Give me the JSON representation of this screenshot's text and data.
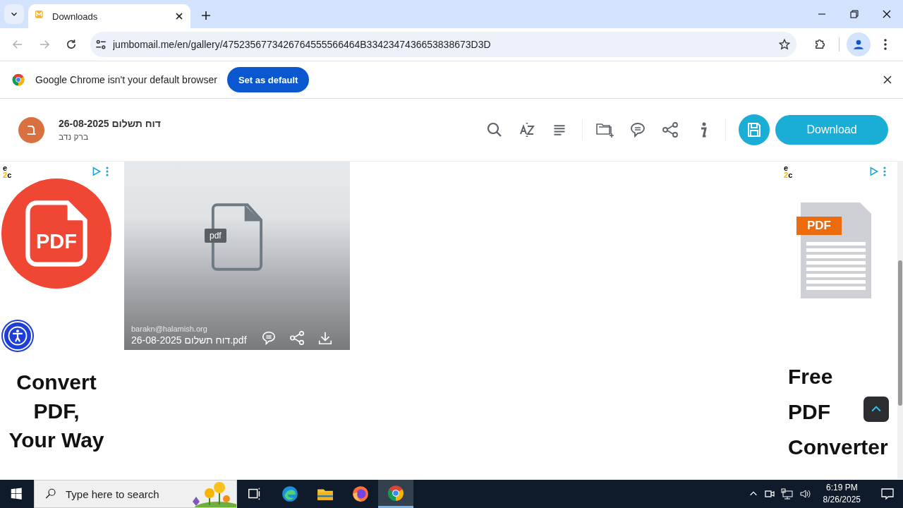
{
  "browser": {
    "tabs": [
      {
        "title": "Downloads",
        "selected": true
      }
    ],
    "address": "jumbomail.me/en/gallery/4752356773426764555566464B3342347436653838673D3D",
    "infobar": {
      "message": "Google Chrome isn't your default browser",
      "button": "Set as default"
    }
  },
  "header": {
    "avatar_letter": "ב",
    "title": "דוח תשלום 26-08-2025",
    "subtitle": "ברק נדב",
    "download_button": "Download"
  },
  "left_ad": {
    "logo_lines": [
      "e",
      "2c"
    ],
    "icon_text": "PDF",
    "headline_lines": [
      "Convert",
      "PDF,",
      "Your Way"
    ]
  },
  "file_card": {
    "type_badge": "pdf",
    "sender": "barakn@halamish.org",
    "file_name": "דוח תשלום 26-08-2025.pdf"
  },
  "right_ad": {
    "logo_lines": [
      "e",
      "2c"
    ],
    "badge": "PDF",
    "headline_lines": [
      "Free",
      "PDF",
      "Converter"
    ]
  },
  "taskbar": {
    "search_placeholder": "Type here to search",
    "apps": [
      {
        "kind": "taskview",
        "selected": false
      },
      {
        "kind": "edge",
        "selected": false
      },
      {
        "kind": "files",
        "selected": false
      },
      {
        "kind": "firefox",
        "selected": false
      },
      {
        "kind": "chrome",
        "selected": true
      }
    ],
    "time": "6:19 PM",
    "date": "8/26/2025"
  }
}
